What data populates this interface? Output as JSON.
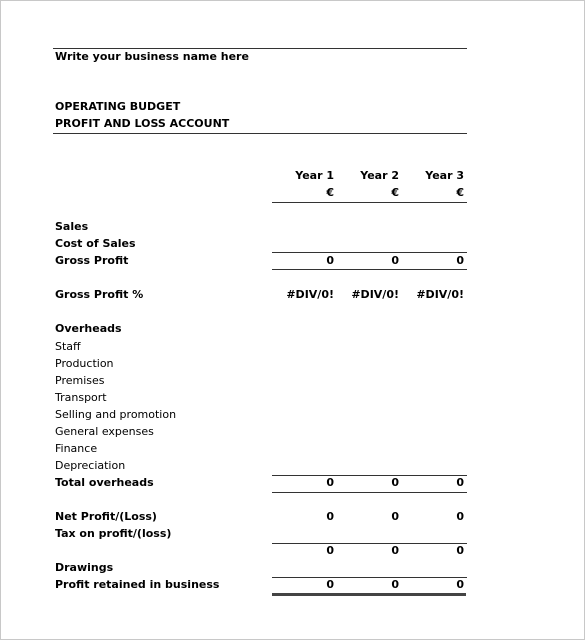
{
  "document": {
    "business_name": "Write your business name here",
    "title_line1": "OPERATING BUDGET",
    "title_line2": "PROFIT AND LOSS ACCOUNT"
  },
  "columns": [
    {
      "label": "Year 1",
      "currency": "€"
    },
    {
      "label": "Year 2",
      "currency": "€"
    },
    {
      "label": "Year 3",
      "currency": "€"
    }
  ],
  "rows": {
    "sales": {
      "label": "Sales"
    },
    "cost_of_sales": {
      "label": "Cost of Sales"
    },
    "gross_profit": {
      "label": "Gross Profit",
      "values": [
        "0",
        "0",
        "0"
      ]
    },
    "gross_profit_pct": {
      "label": "Gross Profit %",
      "values": [
        "#DIV/0!",
        "#DIV/0!",
        "#DIV/0!"
      ]
    },
    "overheads": {
      "label": "Overheads"
    },
    "staff": {
      "label": "Staff"
    },
    "production": {
      "label": "Production"
    },
    "premises": {
      "label": "Premises"
    },
    "transport": {
      "label": "Transport"
    },
    "selling": {
      "label": "Selling and promotion"
    },
    "general": {
      "label": "General expenses"
    },
    "finance": {
      "label": "Finance"
    },
    "depreciation": {
      "label": "Depreciation"
    },
    "total_overheads": {
      "label": "Total overheads",
      "values": [
        "0",
        "0",
        "0"
      ]
    },
    "net_profit": {
      "label": "Net Profit/(Loss)",
      "values": [
        "0",
        "0",
        "0"
      ]
    },
    "tax": {
      "label": "Tax on profit/(loss)"
    },
    "after_tax": {
      "label": "",
      "values": [
        "0",
        "0",
        "0"
      ]
    },
    "drawings": {
      "label": "Drawings"
    },
    "retained": {
      "label": "Profit retained in business",
      "values": [
        "0",
        "0",
        "0"
      ]
    }
  }
}
